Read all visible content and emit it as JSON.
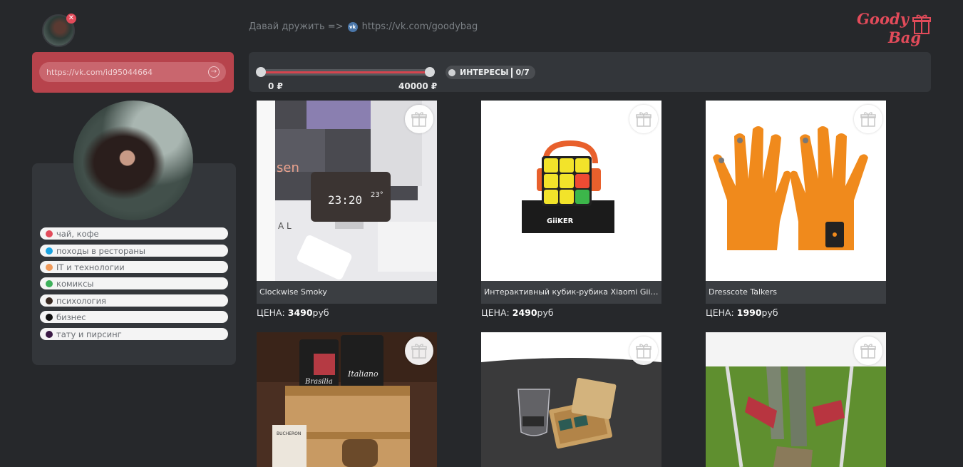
{
  "header": {
    "friend_text": "Давай дружить =>",
    "vk_link": "https://vk.com/goodybag",
    "logo": {
      "line1": "Goody",
      "line2": "Bag"
    }
  },
  "profile_input": {
    "value": "https://vk.com/id95044664"
  },
  "interests": [
    {
      "label": "чай, кофе",
      "color": "#e24b5a"
    },
    {
      "label": "походы в рестораны",
      "color": "#1aa3e0"
    },
    {
      "label": "IT и технологии",
      "color": "#f09a5a"
    },
    {
      "label": "комиксы",
      "color": "#3db05a"
    },
    {
      "label": "психология",
      "color": "#3a2a22"
    },
    {
      "label": "бизнес",
      "color": "#111111"
    },
    {
      "label": "тату и пирсинг",
      "color": "#3a1a45"
    }
  ],
  "filters": {
    "price_min_label": "0 ₽",
    "price_max_label": "40000 ₽",
    "interests_label": "ИНТЕРЕСЫ",
    "interests_count": "0/7",
    "accent": "#d6454f"
  },
  "products": [
    {
      "name": "Clockwise Smoky",
      "price_prefix": "ЦЕНА:",
      "price": "3490",
      "currency": "руб"
    },
    {
      "name": "Интерактивный кубик-рубика Xiaomi Giiker",
      "price_prefix": "ЦЕНА:",
      "price": "2490",
      "currency": "руб"
    },
    {
      "name": "Dresscote Talkers",
      "price_prefix": "ЦЕНА:",
      "price": "1990",
      "currency": "руб"
    },
    {
      "name": "",
      "price_prefix": "",
      "price": "",
      "currency": ""
    },
    {
      "name": "",
      "price_prefix": "",
      "price": "",
      "currency": ""
    },
    {
      "name": "",
      "price_prefix": "",
      "price": "",
      "currency": ""
    }
  ]
}
